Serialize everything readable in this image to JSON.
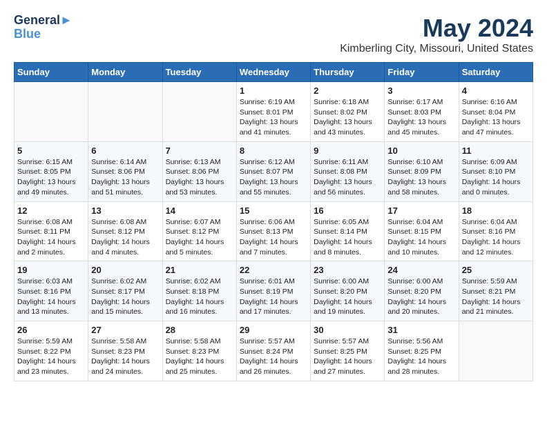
{
  "logo": {
    "line1": "General",
    "line2": "Blue"
  },
  "title": "May 2024",
  "subtitle": "Kimberling City, Missouri, United States",
  "weekdays": [
    "Sunday",
    "Monday",
    "Tuesday",
    "Wednesday",
    "Thursday",
    "Friday",
    "Saturday"
  ],
  "weeks": [
    [
      {
        "day": "",
        "info": ""
      },
      {
        "day": "",
        "info": ""
      },
      {
        "day": "",
        "info": ""
      },
      {
        "day": "1",
        "info": "Sunrise: 6:19 AM\nSunset: 8:01 PM\nDaylight: 13 hours\nand 41 minutes."
      },
      {
        "day": "2",
        "info": "Sunrise: 6:18 AM\nSunset: 8:02 PM\nDaylight: 13 hours\nand 43 minutes."
      },
      {
        "day": "3",
        "info": "Sunrise: 6:17 AM\nSunset: 8:03 PM\nDaylight: 13 hours\nand 45 minutes."
      },
      {
        "day": "4",
        "info": "Sunrise: 6:16 AM\nSunset: 8:04 PM\nDaylight: 13 hours\nand 47 minutes."
      }
    ],
    [
      {
        "day": "5",
        "info": "Sunrise: 6:15 AM\nSunset: 8:05 PM\nDaylight: 13 hours\nand 49 minutes."
      },
      {
        "day": "6",
        "info": "Sunrise: 6:14 AM\nSunset: 8:06 PM\nDaylight: 13 hours\nand 51 minutes."
      },
      {
        "day": "7",
        "info": "Sunrise: 6:13 AM\nSunset: 8:06 PM\nDaylight: 13 hours\nand 53 minutes."
      },
      {
        "day": "8",
        "info": "Sunrise: 6:12 AM\nSunset: 8:07 PM\nDaylight: 13 hours\nand 55 minutes."
      },
      {
        "day": "9",
        "info": "Sunrise: 6:11 AM\nSunset: 8:08 PM\nDaylight: 13 hours\nand 56 minutes."
      },
      {
        "day": "10",
        "info": "Sunrise: 6:10 AM\nSunset: 8:09 PM\nDaylight: 13 hours\nand 58 minutes."
      },
      {
        "day": "11",
        "info": "Sunrise: 6:09 AM\nSunset: 8:10 PM\nDaylight: 14 hours\nand 0 minutes."
      }
    ],
    [
      {
        "day": "12",
        "info": "Sunrise: 6:08 AM\nSunset: 8:11 PM\nDaylight: 14 hours\nand 2 minutes."
      },
      {
        "day": "13",
        "info": "Sunrise: 6:08 AM\nSunset: 8:12 PM\nDaylight: 14 hours\nand 4 minutes."
      },
      {
        "day": "14",
        "info": "Sunrise: 6:07 AM\nSunset: 8:12 PM\nDaylight: 14 hours\nand 5 minutes."
      },
      {
        "day": "15",
        "info": "Sunrise: 6:06 AM\nSunset: 8:13 PM\nDaylight: 14 hours\nand 7 minutes."
      },
      {
        "day": "16",
        "info": "Sunrise: 6:05 AM\nSunset: 8:14 PM\nDaylight: 14 hours\nand 8 minutes."
      },
      {
        "day": "17",
        "info": "Sunrise: 6:04 AM\nSunset: 8:15 PM\nDaylight: 14 hours\nand 10 minutes."
      },
      {
        "day": "18",
        "info": "Sunrise: 6:04 AM\nSunset: 8:16 PM\nDaylight: 14 hours\nand 12 minutes."
      }
    ],
    [
      {
        "day": "19",
        "info": "Sunrise: 6:03 AM\nSunset: 8:16 PM\nDaylight: 14 hours\nand 13 minutes."
      },
      {
        "day": "20",
        "info": "Sunrise: 6:02 AM\nSunset: 8:17 PM\nDaylight: 14 hours\nand 15 minutes."
      },
      {
        "day": "21",
        "info": "Sunrise: 6:02 AM\nSunset: 8:18 PM\nDaylight: 14 hours\nand 16 minutes."
      },
      {
        "day": "22",
        "info": "Sunrise: 6:01 AM\nSunset: 8:19 PM\nDaylight: 14 hours\nand 17 minutes."
      },
      {
        "day": "23",
        "info": "Sunrise: 6:00 AM\nSunset: 8:20 PM\nDaylight: 14 hours\nand 19 minutes."
      },
      {
        "day": "24",
        "info": "Sunrise: 6:00 AM\nSunset: 8:20 PM\nDaylight: 14 hours\nand 20 minutes."
      },
      {
        "day": "25",
        "info": "Sunrise: 5:59 AM\nSunset: 8:21 PM\nDaylight: 14 hours\nand 21 minutes."
      }
    ],
    [
      {
        "day": "26",
        "info": "Sunrise: 5:59 AM\nSunset: 8:22 PM\nDaylight: 14 hours\nand 23 minutes."
      },
      {
        "day": "27",
        "info": "Sunrise: 5:58 AM\nSunset: 8:23 PM\nDaylight: 14 hours\nand 24 minutes."
      },
      {
        "day": "28",
        "info": "Sunrise: 5:58 AM\nSunset: 8:23 PM\nDaylight: 14 hours\nand 25 minutes."
      },
      {
        "day": "29",
        "info": "Sunrise: 5:57 AM\nSunset: 8:24 PM\nDaylight: 14 hours\nand 26 minutes."
      },
      {
        "day": "30",
        "info": "Sunrise: 5:57 AM\nSunset: 8:25 PM\nDaylight: 14 hours\nand 27 minutes."
      },
      {
        "day": "31",
        "info": "Sunrise: 5:56 AM\nSunset: 8:25 PM\nDaylight: 14 hours\nand 28 minutes."
      },
      {
        "day": "",
        "info": ""
      }
    ]
  ]
}
